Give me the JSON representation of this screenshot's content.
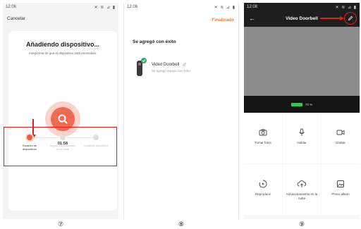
{
  "screen1": {
    "time": "12:06",
    "status_icons": "✕ ≋ ⊿ ▮",
    "cancel_label": "Cancelar",
    "title": "Añadiendo dispositivo...",
    "subtitle": "Asegúrese de que el dispositivo está encendido.",
    "timer": "01:58",
    "steps": [
      {
        "label": "Escaneo de dispositivos",
        "active": true
      },
      {
        "label": "Registro al dispositivo en la nube",
        "active": false
      },
      {
        "label": "Inicializar dispositivo",
        "active": false
      }
    ],
    "accent_color": "#f06a50",
    "caption": "⑦"
  },
  "screen2": {
    "time": "12:06",
    "status_icons": "✕ ≋ ⊿ ▮",
    "done_label": "Finalizado",
    "heading": "Se agregó con éxito",
    "device_name": "Video Doorbell",
    "device_sub": "Se agregó equipo con éxito",
    "accent_color": "#f07a1e",
    "caption": "⑧"
  },
  "screen3": {
    "time": "12:08",
    "status_icons": "✕ ≋ ⊿ ▮",
    "title": "Video Doorbell",
    "battery_text": "70 %",
    "battery_level": 0.7,
    "actions": [
      {
        "label": "Tomar fotos",
        "icon": "camera-icon"
      },
      {
        "label": "Hablar",
        "icon": "microphone-icon"
      },
      {
        "label": "Grabar",
        "icon": "video-record-icon"
      },
      {
        "label": "Reproducir",
        "icon": "playback-icon"
      },
      {
        "label": "Almacenamiento en la nube",
        "icon": "cloud-upload-icon"
      },
      {
        "label": "Photo album",
        "icon": "image-icon"
      }
    ],
    "caption": "⑨"
  }
}
